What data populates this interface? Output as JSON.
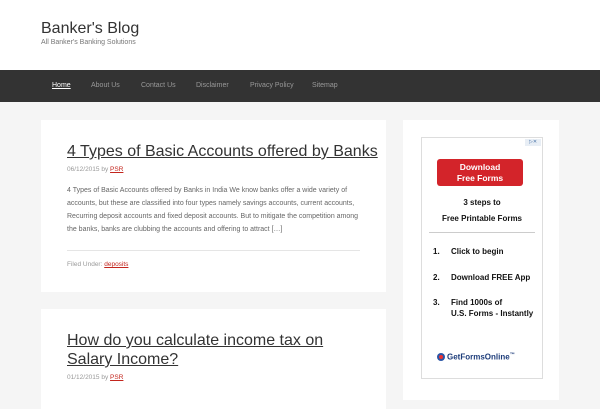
{
  "header": {
    "title": "Banker's Blog",
    "description": "All Banker's Banking Solutions"
  },
  "nav": {
    "items": [
      {
        "label": "Home",
        "active": true
      },
      {
        "label": "About Us"
      },
      {
        "label": "Contact Us"
      },
      {
        "label": "Disclaimer"
      },
      {
        "label": "Privacy Policy"
      },
      {
        "label": "Sitemap"
      }
    ]
  },
  "posts": [
    {
      "title": "4 Types of Basic Accounts offered by Banks",
      "date": "06/12/2015",
      "by": "by",
      "author": "PSR",
      "excerpt": "4 Types of Basic Accounts offered by Banks in India We know banks offer a wide variety of accounts, but these are classified into four types namely savings accounts, current accounts, Recurring deposit accounts and fixed deposit accounts. But to mitigate the competition among the banks, banks are clubbing the accounts and offering to attract […]",
      "filed_label": "Filed Under:",
      "category": "deposits"
    },
    {
      "title": "How do you calculate income tax on Salary Income?",
      "date": "01/12/2015",
      "by": "by",
      "author": "PSR"
    }
  ],
  "ad": {
    "marker": "▷✕",
    "button": "Download Free Forms",
    "button_line1": "Download",
    "button_line2": "Free Forms",
    "heading1": "3 steps to",
    "heading2": "Free Printable Forms",
    "steps": [
      {
        "num": "1.",
        "text": "Click to begin",
        "text2": ""
      },
      {
        "num": "2.",
        "text": "Download FREE App",
        "text2": ""
      },
      {
        "num": "3.",
        "text": "Find 1000s of",
        "text2": "U.S. Forms - Instantly"
      }
    ],
    "logo_text": "GetFormsOnline",
    "logo_tm": "™"
  }
}
